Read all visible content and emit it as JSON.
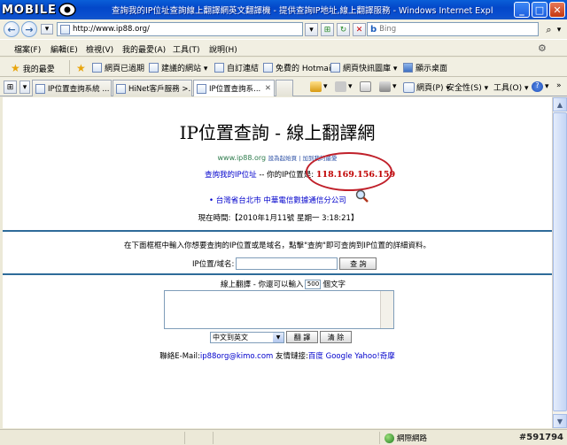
{
  "titlebar": {
    "logo_text": "MOBILE",
    "title": "查詢我的IP位址查詢線上翻譯網英文翻譯機 - 提供查詢IP地址,線上翻譯服務 - Windows Internet Explorer"
  },
  "address": {
    "url": "http://www.ip88.org/",
    "search_placeholder": "Bing",
    "search_engine": "b"
  },
  "menu": {
    "items": [
      "檔案(F)",
      "編輯(E)",
      "檢視(V)",
      "我的最愛(A)",
      "工具(T)",
      "說明(H)"
    ]
  },
  "favorites": {
    "label": "我的最愛",
    "links": [
      "網頁已過期",
      "建議的網站 ▾",
      "自訂連結",
      "免費的 Hotmail",
      "網頁快訊圖庫 ▾",
      "顯示桌面"
    ]
  },
  "tabs": {
    "items": [
      "IP位置查詢系統 ...",
      "HiNet客戶服務 >...",
      "IP位置查詢系..."
    ],
    "close": "✕"
  },
  "command_bar": {
    "page_label": "網頁(P) ▾",
    "safety_label": "安全性(S) ▾",
    "tools_label": "工具(O) ▾",
    "help_label": "?"
  },
  "page": {
    "heading": "IP位置查詢 - 線上翻譯網",
    "domain": "www.ip88.org",
    "domain_tail": "設為起始頁 | 加到我的最愛",
    "ip_link": "查詢我的IP位址",
    "ip_sep": " -- 你的IP位置是: ",
    "ip_value": "118.169.156.159",
    "location_bullet": "•",
    "location": "台灣省台北市 中華電信數據通信分公司",
    "time_label": "現在時間:【2010年1月11號 星期一 3:18:21】",
    "instruction": "在下面框框中輸入你想要查詢的IP位置或是域名，點擊\"查詢\"即可查詢到IP位置的詳細資料。",
    "ip_field_label": "IP位置/域名:",
    "query_button": "查 詢",
    "translate_title": "線上翻譯 - 你還可以輸入",
    "translate_count": "500",
    "translate_unit": "個文字",
    "lang_select": "中文到英文",
    "translate_button": "翻 譯",
    "clear_button": "清 除",
    "contact_prefix": "聯絡E-Mail:",
    "contact_email": "ip88org@kimo.com",
    "contact_mid": " 友情鏈接:",
    "friend_links": "百度 Google Yahoo!奇摩"
  },
  "statusbar": {
    "zone": "網際網路",
    "watermark": "#591794"
  }
}
